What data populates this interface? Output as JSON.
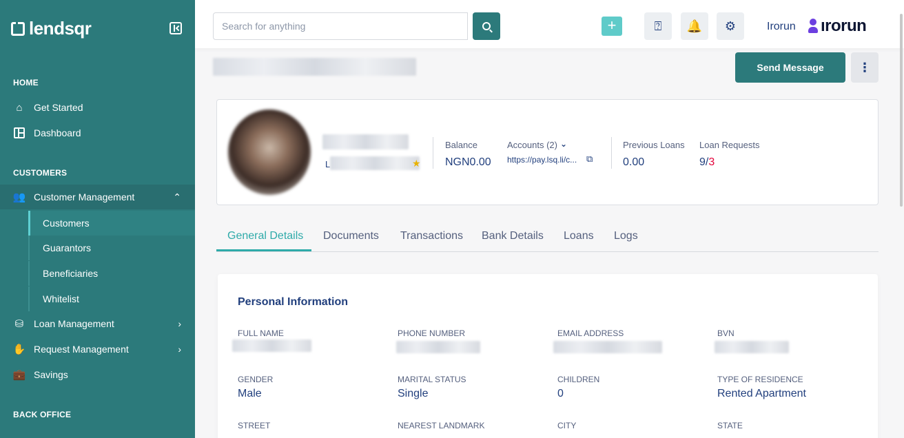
{
  "sidebar": {
    "brand": "lendsqr",
    "sections": {
      "home": "HOME",
      "customers": "CUSTOMERS",
      "back_office": "BACK OFFICE"
    },
    "items": {
      "get_started": "Get Started",
      "dashboard": "Dashboard",
      "customer_management": "Customer Management",
      "customers": "Customers",
      "guarantors": "Guarantors",
      "beneficiaries": "Beneficiaries",
      "whitelist": "Whitelist",
      "loan_management": "Loan Management",
      "request_management": "Request Management",
      "savings": "Savings"
    }
  },
  "topbar": {
    "search_placeholder": "Search for anything",
    "user_name": "Irorun",
    "org_brand": "ırorun"
  },
  "header": {
    "send_message": "Send Message"
  },
  "summary": {
    "tier_prefix": "L",
    "balance_label": "Balance",
    "balance_value": "NGN0.00",
    "accounts_label": "Accounts (2)",
    "accounts_link": "https://pay.lsq.li/c...",
    "previous_loans_label": "Previous Loans",
    "previous_loans_value": "0.00",
    "loan_requests_label": "Loan Requests",
    "loan_requests_main": "9/",
    "loan_requests_alt": "3"
  },
  "tabs": [
    "General Details",
    "Documents",
    "Transactions",
    "Bank Details",
    "Loans",
    "Logs"
  ],
  "personal_info": {
    "title": "Personal Information",
    "full_name_label": "FULL NAME",
    "phone_label": "PHONE NUMBER",
    "email_label": "EMAIL ADDRESS",
    "bvn_label": "BVN",
    "gender_label": "GENDER",
    "gender_value": "Male",
    "marital_label": "MARITAL STATUS",
    "marital_value": "Single",
    "children_label": "CHILDREN",
    "children_value": "0",
    "residence_label": "TYPE OF RESIDENCE",
    "residence_value": "Rented Apartment",
    "street_label": "STREET",
    "landmark_label": "NEAREST LANDMARK",
    "city_label": "CITY",
    "state_label": "STATE"
  },
  "colors": {
    "sidebar_bg": "#2c7a7b",
    "accent": "#2eaaa9",
    "text_primary": "#213f7d",
    "danger": "#e4033b"
  }
}
